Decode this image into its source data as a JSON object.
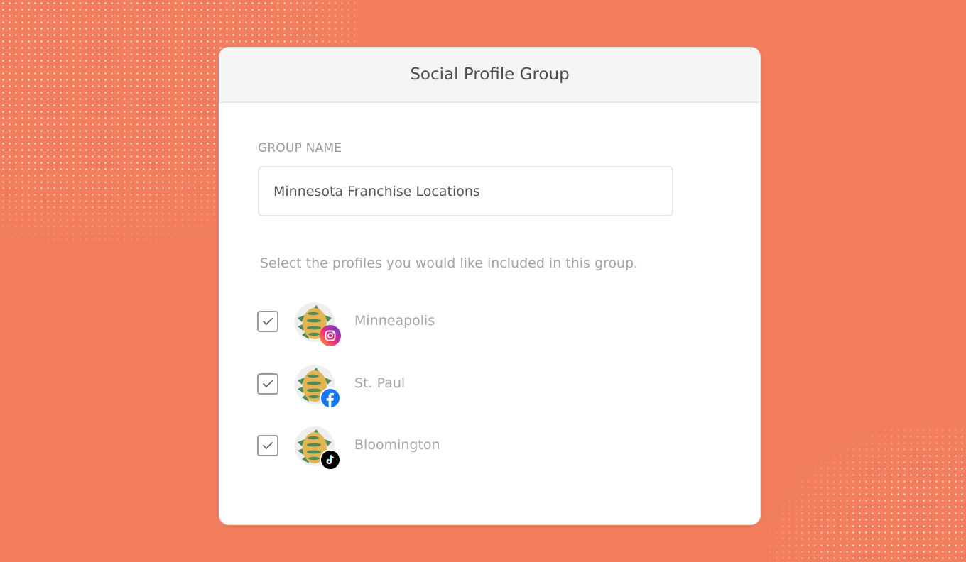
{
  "dialog": {
    "title": "Social Profile Group",
    "group_name_label": "GROUP NAME",
    "group_name_value": "Minnesota Franchise Locations",
    "instructions": "Select the profiles you would like included in this group.",
    "profiles": [
      {
        "name": "Minneapolis",
        "network": "instagram-icon",
        "checked": true
      },
      {
        "name": "St. Paul",
        "network": "facebook-icon",
        "checked": true
      },
      {
        "name": "Bloomington",
        "network": "tiktok-icon",
        "checked": true
      }
    ]
  },
  "colors": {
    "background": "#F27E5E",
    "card": "#FFFFFF",
    "header": "#F5F5F5",
    "facebook": "#1877F2",
    "tiktok": "#000000"
  }
}
